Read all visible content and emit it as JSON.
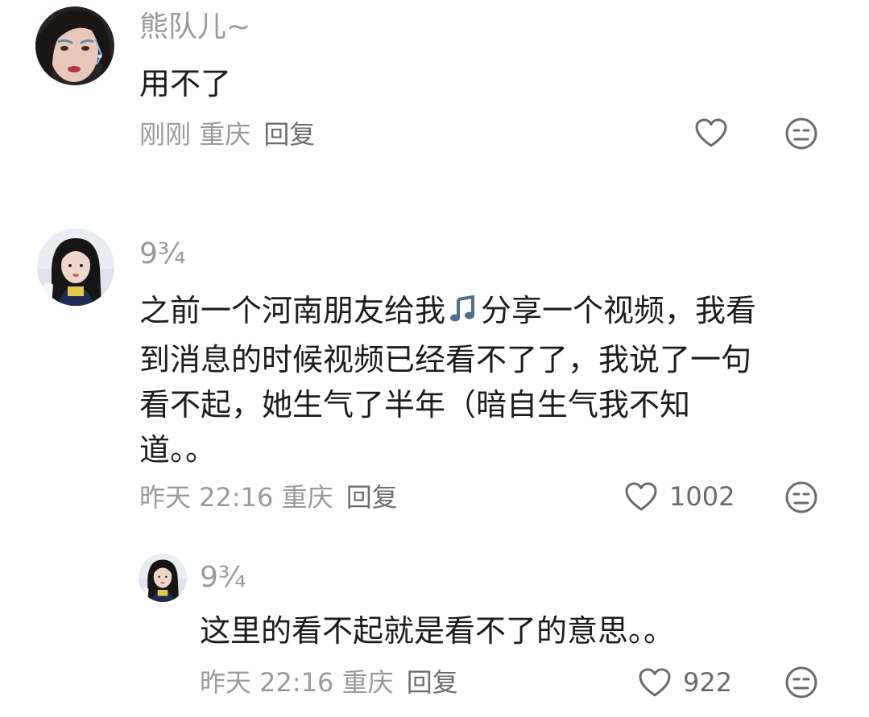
{
  "comments": [
    {
      "username": "熊队儿~",
      "content_lines": [
        "用不了"
      ],
      "time": "刚刚",
      "location": "重庆",
      "reply_label": "回复",
      "likes": ""
    },
    {
      "username": "9¾",
      "content_line1_pre": "之前一个河南朋友给我",
      "content_line1_post": "分享一个视频，我看",
      "content_lines": [
        "到消息的时候视频已经看不了了，我说了一句",
        "看不起，她生气了半年（暗自生气我不知",
        "道。。"
      ],
      "time": "昨天 22:16",
      "location": "重庆",
      "reply_label": "回复",
      "likes": "1002"
    },
    {
      "username": "9¾",
      "content_lines": [
        "这里的看不起就是看不了的意思。。"
      ],
      "time": "昨天 22:16",
      "location": "重庆",
      "reply_label": "回复",
      "likes": "922"
    }
  ],
  "colors": {
    "meta_text": "#9a9a9a",
    "content_text": "#1c1c1c",
    "icon_stroke": "#6b6b6b",
    "music_icon": "#4f6f8a"
  }
}
